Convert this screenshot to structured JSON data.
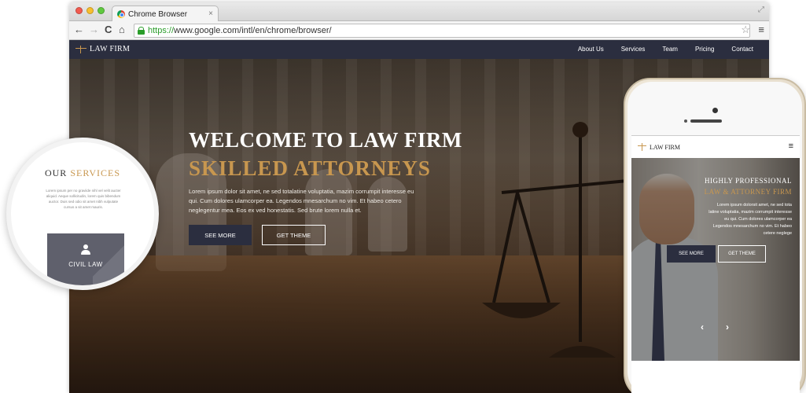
{
  "browser": {
    "tab_title": "Chrome Browser",
    "tab_close": "×",
    "url_scheme": "https://",
    "url_rest": "www.google.com/intl/en/chrome/browser/",
    "back": "←",
    "forward": "→",
    "reload": "C",
    "home": "⌂",
    "star": "☆",
    "menu": "≡",
    "expand": "⤢"
  },
  "site": {
    "brand": "LAW FIRM",
    "nav": [
      "About Us",
      "Services",
      "Team",
      "Pricing",
      "Contact"
    ],
    "hero": {
      "title": "WELCOME TO LAW FIRM",
      "subtitle": "SKILLED ATTORNEYS",
      "text": "Lorem ipsum dolor sit amet, ne sed totalatine voluptatia, mazim corrumpit interesse eu qui. Cum dolores ulamcorper ea. Legendos mnesarchum no vim. Et habeo cetero neglegentur mea. Eos ex ved honestatis. Sed brute lorem nulla et.",
      "btn_primary": "SEE MORE",
      "btn_secondary": "GET THEME"
    }
  },
  "magnifier": {
    "title_part1": "OUR",
    "title_part2": "SERVICES",
    "text": "Lorem ipsum per no graviide nihl vel velit aucter aliquid. Aeque sollicitudin, lorem quis bibendum auctor. Duis sed odio sit amet nibh vulputate cursus a sit amet mauris.",
    "card_label": "CIVIL LAW",
    "card_icon": "user-icon"
  },
  "phone": {
    "brand": "LAW FIRM",
    "hamburger": "≡",
    "title1": "HIGHLY PROFESSIONAL",
    "title2": "LAW & ATTORNEY FIRM",
    "text": "Lorem ipsum dolorsit amet, ne sed tota latine voluptatia, mazim corrumpit interesse eu qui. Cum dolores ulamcorper ea Legendos mnesarchum no vim. Et habeo cetere neglege",
    "btn_primary": "SEE MORE",
    "btn_secondary": "GET THEME",
    "prev": "‹",
    "next": "›"
  },
  "colors": {
    "navy": "#2b2e3f",
    "gold": "#c8974f"
  }
}
